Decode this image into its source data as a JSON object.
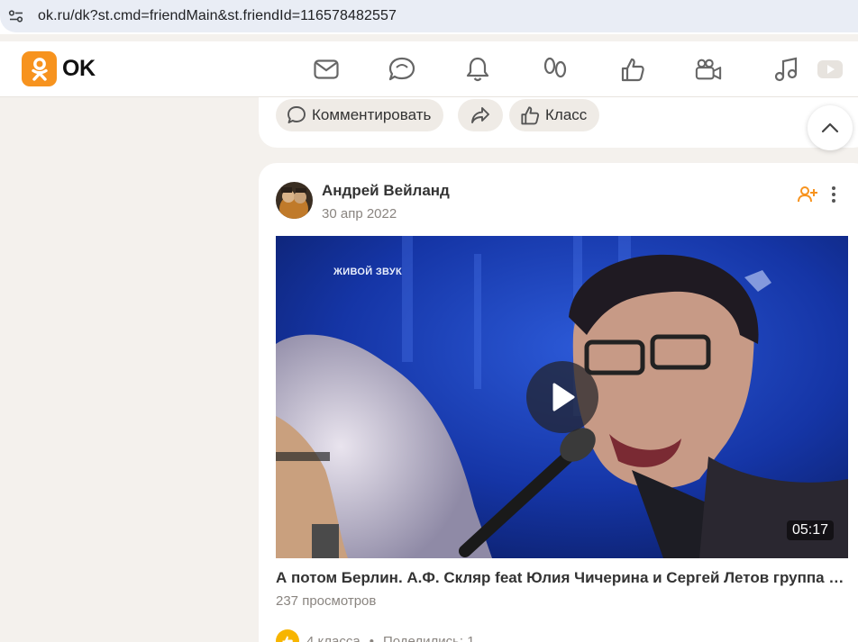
{
  "browser": {
    "url": "ok.ru/dk?st.cmd=friendMain&st.friendId=116578482557",
    "site_icon": "tune-icon"
  },
  "header": {
    "logo_text": "OK",
    "nav_icons": [
      "messages-icon",
      "discussions-icon",
      "notifications-icon",
      "guests-icon",
      "marks-icon",
      "video-icon",
      "music-icon",
      "games-icon"
    ],
    "brand_color": "#f7931e"
  },
  "previous_post": {
    "comment_label": "Комментировать",
    "share_icon": "share-icon",
    "like_label": "Класс"
  },
  "post": {
    "author": "Андрей Вейланд",
    "date": "30 апр 2022",
    "video": {
      "watermark": "ЖИВОЙ ЗВУК",
      "duration": "05:17",
      "title": "А потом Берлин. А.Ф. Скляр feat Юлия Чичерина и Сергей Летов группа Ва-Банкъ",
      "views": "237 просмотров"
    },
    "likes": "4 класса",
    "shares": "Поделились: 1"
  }
}
